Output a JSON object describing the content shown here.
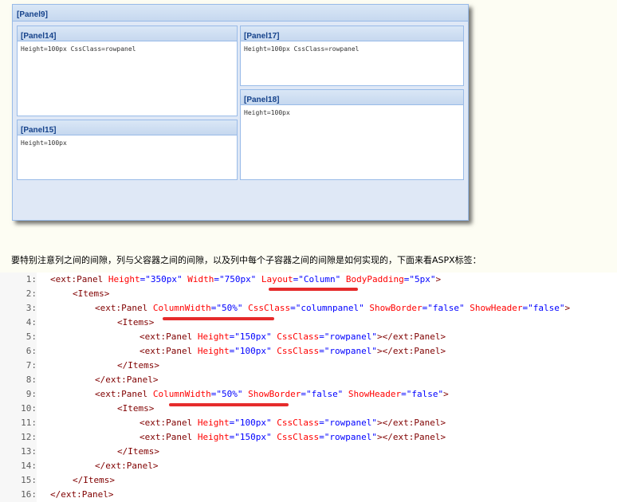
{
  "screenshot": {
    "outer_panel_title": "[Panel9]",
    "panels": [
      {
        "title": "[Panel14]",
        "body": "Height=100px CssClass=rowpanel"
      },
      {
        "title": "[Panel15]",
        "body": "Height=100px"
      },
      {
        "title": "[Panel17]",
        "body": "Height=100px CssClass=rowpanel"
      },
      {
        "title": "[Panel18]",
        "body": "Height=100px"
      }
    ]
  },
  "description": "要特别注意列之间的间隙，列与父容器之间的间隙，以及列中每个子容器之间的间隙是如何实现的，下面来看ASPX标签：",
  "code": {
    "line_numbers": [
      "1:",
      "2:",
      "3:",
      "4:",
      "5:",
      "6:",
      "7:",
      "8:",
      "9:",
      "10:",
      "11:",
      "12:",
      "13:",
      "14:",
      "15:",
      "16:"
    ],
    "l1": {
      "t": "<ext:Panel",
      "a1": " Height",
      "v1": "=\"350px\"",
      "a2": " Width",
      "v2": "=\"750px\"",
      "a3": " Layout",
      "v3": "=\"Column\"",
      "a4": " BodyPadding",
      "v4": "=\"5px\"",
      "e": ">"
    },
    "l2": {
      "t": "<Items>"
    },
    "l3": {
      "t": "<ext:Panel",
      "a1": " ColumnWidth",
      "v1": "=\"50%\"",
      "a2": " CssClass",
      "v2": "=\"columnpanel\"",
      "a3": " ShowBorder",
      "v3": "=\"false\"",
      "a4": " ShowHeader",
      "v4": "=\"false\"",
      "e": ">"
    },
    "l4": {
      "t": "<Items>"
    },
    "l5": {
      "t": "<ext:Panel",
      "a1": " Height",
      "v1": "=\"150px\"",
      "a2": " CssClass",
      "v2": "=\"rowpanel\"",
      "e": "></ext:Panel>"
    },
    "l6": {
      "t": "<ext:Panel",
      "a1": " Height",
      "v1": "=\"100px\"",
      "a2": " CssClass",
      "v2": "=\"rowpanel\"",
      "e": "></ext:Panel>"
    },
    "l7": {
      "t": "</Items>"
    },
    "l8": {
      "t": "</ext:Panel>"
    },
    "l9": {
      "t": "<ext:Panel",
      "a1": " ColumnWidth",
      "v1": "=\"50%\"",
      "a2": " ShowBorder",
      "v2": "=\"false\"",
      "a3": " ShowHeader",
      "v3": "=\"false\"",
      "e": ">"
    },
    "l10": {
      "t": "<Items>"
    },
    "l11": {
      "t": "<ext:Panel",
      "a1": " Height",
      "v1": "=\"100px\"",
      "a2": " CssClass",
      "v2": "=\"rowpanel\"",
      "e": "></ext:Panel>"
    },
    "l12": {
      "t": "<ext:Panel",
      "a1": " Height",
      "v1": "=\"150px\"",
      "a2": " CssClass",
      "v2": "=\"rowpanel\"",
      "e": "></ext:Panel>"
    },
    "l13": {
      "t": "</Items>"
    },
    "l14": {
      "t": "</ext:Panel>"
    },
    "l15": {
      "t": "</Items>"
    },
    "l16": {
      "t": "</ext:Panel>"
    }
  }
}
